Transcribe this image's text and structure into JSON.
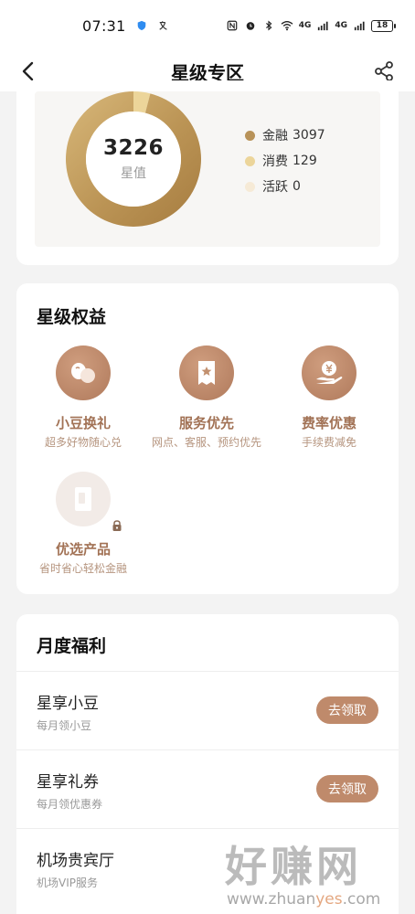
{
  "status_bar": {
    "time": "07:31",
    "battery": "18",
    "net_a": "4G",
    "net_b": "4G"
  },
  "header": {
    "title": "星级专区",
    "back_icon": "chevron-left-icon",
    "share_icon": "share-icon"
  },
  "stats": {
    "total": "3226",
    "total_label": "星值",
    "legend": [
      {
        "label": "金融",
        "value": "3097",
        "color": "#b89258"
      },
      {
        "label": "消费",
        "value": "129",
        "color": "#ecd59a"
      },
      {
        "label": "活跃",
        "value": "0",
        "color": "#f6ead6"
      }
    ]
  },
  "chart_data": {
    "type": "pie",
    "categories": [
      "金融",
      "消费",
      "活跃"
    ],
    "values": [
      3097,
      129,
      0
    ],
    "title": "",
    "center_value": 3226,
    "center_label": "星值",
    "legend": "right"
  },
  "benefits": {
    "title": "星级权益",
    "items": [
      {
        "name": "小豆换礼",
        "desc": "超多好物随心兑",
        "icon": "beans-icon",
        "locked": false
      },
      {
        "name": "服务优先",
        "desc": "网点、客服、预约优先",
        "icon": "ticket-star-icon",
        "locked": false
      },
      {
        "name": "费率优惠",
        "desc": "手续费减免",
        "icon": "coin-hand-icon",
        "locked": false
      },
      {
        "name": "优选产品",
        "desc": "省时省心轻松金融",
        "icon": "card-icon",
        "locked": true
      }
    ]
  },
  "monthly": {
    "title": "月度福利",
    "rows": [
      {
        "title": "星享小豆",
        "subtitle": "每月领小豆",
        "button": "去领取"
      },
      {
        "title": "星享礼券",
        "subtitle": "每月领优惠券",
        "button": "去领取"
      },
      {
        "title": "机场贵宾厅",
        "subtitle": "机场VIP服务",
        "button": ""
      }
    ]
  },
  "watermark": {
    "brand": "好赚网",
    "url_prefix": "www.zhuan",
    "url_accent": "yes",
    "url_suffix": ".com"
  }
}
